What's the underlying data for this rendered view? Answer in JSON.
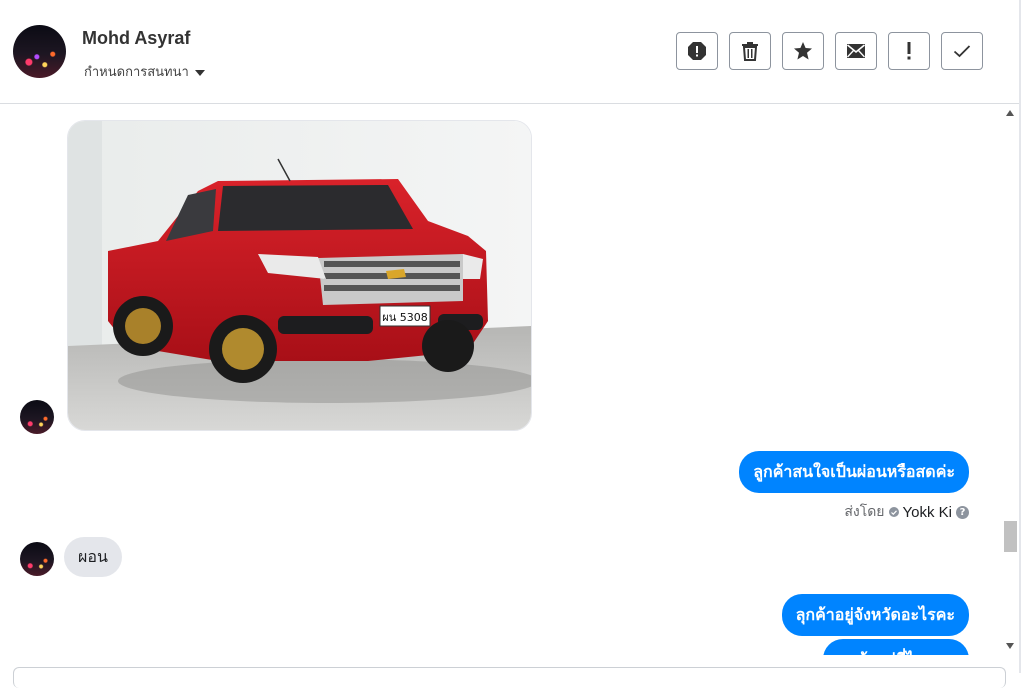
{
  "header": {
    "contact_name": "Mohd Asyraf",
    "thread_label": "กำหนดการสนทนา",
    "actions": [
      {
        "icon": "alert-octagon-icon",
        "name": "report-button"
      },
      {
        "icon": "trash-icon",
        "name": "delete-button"
      },
      {
        "icon": "star-icon",
        "name": "star-button"
      },
      {
        "icon": "envelope-icon",
        "name": "mark-unread-button"
      },
      {
        "icon": "exclamation-icon",
        "name": "spam-button"
      },
      {
        "icon": "check-icon",
        "name": "done-button"
      }
    ]
  },
  "messages": [
    {
      "type": "image",
      "direction": "in",
      "alt": "red pickup truck",
      "plate": "ผน 5308"
    },
    {
      "type": "text",
      "direction": "out",
      "text": "ลูกค้าสนใจเป็นผ่อนหรือสดค่ะ"
    },
    {
      "type": "text",
      "direction": "in",
      "text": "ผอน"
    },
    {
      "type": "text",
      "direction": "out",
      "text": "ลุกค้าอยู่จังหวัดอะไรคะ"
    },
    {
      "type": "text",
      "direction": "out",
      "text": "ลูกค้าอยู่ที่ไหนคะ"
    }
  ],
  "sent_by": {
    "label": "ส่งโดย",
    "name": "Yokk Ki"
  },
  "colors": {
    "accent": "#0084ff",
    "incoming_bubble": "#e4e6eb",
    "car_red": "#c8161d"
  }
}
